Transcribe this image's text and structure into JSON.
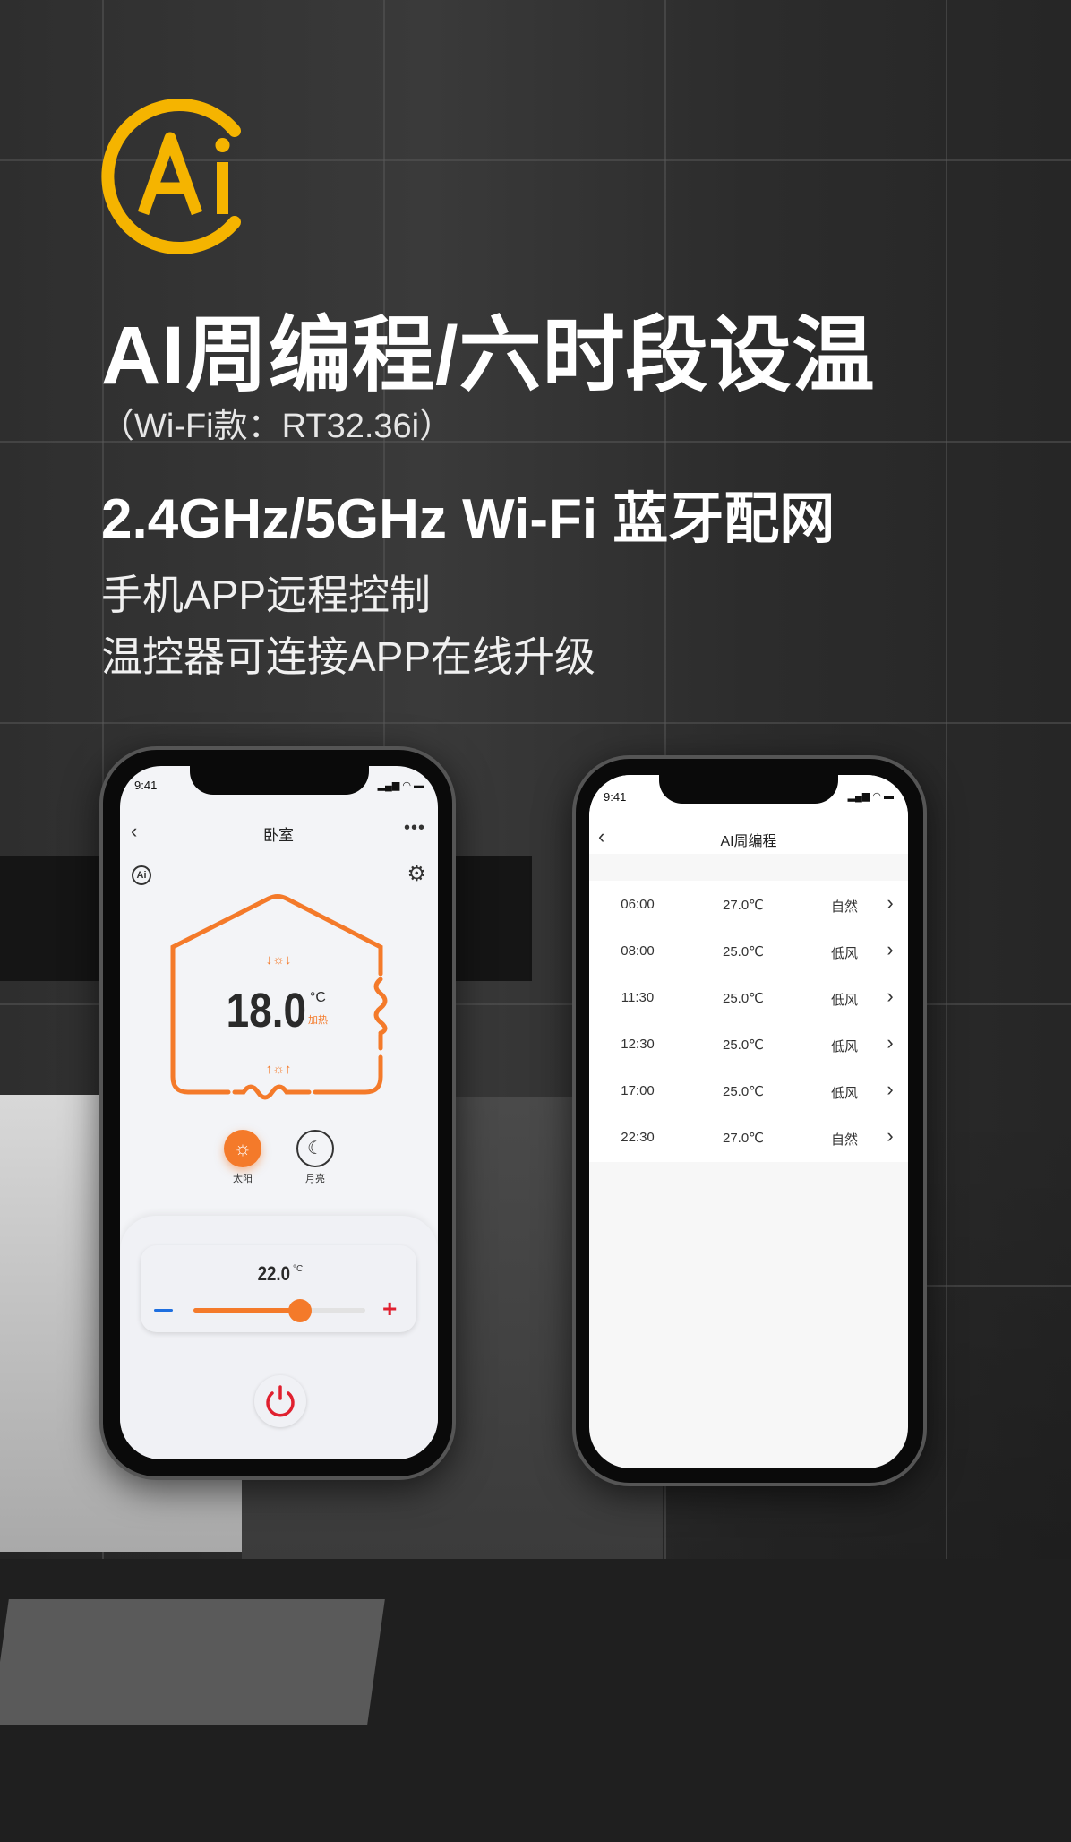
{
  "colors": {
    "logo": "#f5b400",
    "accent": "#f47a2a",
    "minus": "#1e6fe0",
    "plus": "#e0202f",
    "power": "#e0202f"
  },
  "logo": {
    "text": "Ai"
  },
  "headline": "AI周编程/六时段设温",
  "model": "（Wi-Fi款：RT32.36i）",
  "connectivity": "2.4GHz/5GHz Wi-Fi 蓝牙配网",
  "features": [
    "手机APP远程控制",
    "温控器可连接APP在线升级"
  ],
  "left_phone": {
    "status_time": "9:41",
    "title": "卧室",
    "back_icon": "chevron-left-icon",
    "more_icon": "more-dots-icon",
    "ai_icon": "ai-icon",
    "settings_icon": "gear-icon",
    "current_temp": "18.0",
    "temp_unit": "°C",
    "status": "加热",
    "modes": [
      {
        "label": "太阳",
        "icon": "sun-icon",
        "active": true
      },
      {
        "label": "月亮",
        "icon": "moon-icon",
        "active": false
      }
    ],
    "setpoint": "22.0",
    "setpoint_unit": "°C",
    "slider_fraction": 0.62,
    "power_icon": "power-icon"
  },
  "right_phone": {
    "status_time": "9:41",
    "title": "AI周编程",
    "schedule": [
      {
        "time": "06:00",
        "temp": "27.0℃",
        "mode": "自然"
      },
      {
        "time": "08:00",
        "temp": "25.0℃",
        "mode": "低风"
      },
      {
        "time": "11:30",
        "temp": "25.0℃",
        "mode": "低风"
      },
      {
        "time": "12:30",
        "temp": "25.0℃",
        "mode": "低风"
      },
      {
        "time": "17:00",
        "temp": "25.0℃",
        "mode": "低风"
      },
      {
        "time": "22:30",
        "temp": "27.0℃",
        "mode": "自然"
      }
    ]
  }
}
